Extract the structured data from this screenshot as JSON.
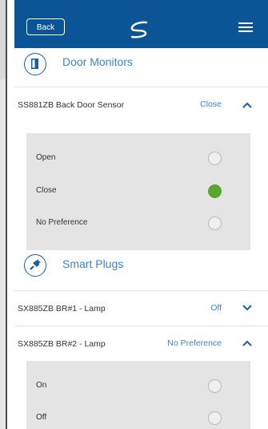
{
  "header": {
    "back_label": "Back",
    "logo_icon": "brand-logo-icon",
    "menu_icon": "hamburger-menu-icon"
  },
  "door_monitors": {
    "title": "Door Monitors",
    "icon": "door-icon",
    "device": {
      "name": "SS881ZB Back Door Sensor",
      "value": "Close",
      "expanded": true
    },
    "options": [
      {
        "label": "Open",
        "selected": false
      },
      {
        "label": "Close",
        "selected": true
      },
      {
        "label": "No Preference",
        "selected": false
      }
    ]
  },
  "smart_plugs": {
    "title": "Smart Plugs",
    "icon": "plug-icon",
    "devices": [
      {
        "name": "SX885ZB BR#1 - Lamp",
        "value": "Off",
        "expanded": false
      },
      {
        "name": "SX885ZB BR#2 - Lamp",
        "value": "No Preference",
        "expanded": true
      }
    ],
    "options": [
      {
        "label": "On",
        "selected": false
      },
      {
        "label": "Off",
        "selected": false
      }
    ]
  },
  "colors": {
    "header_bg": "#0b5495",
    "accent": "#3a86cf",
    "selected": "#58a62b"
  }
}
